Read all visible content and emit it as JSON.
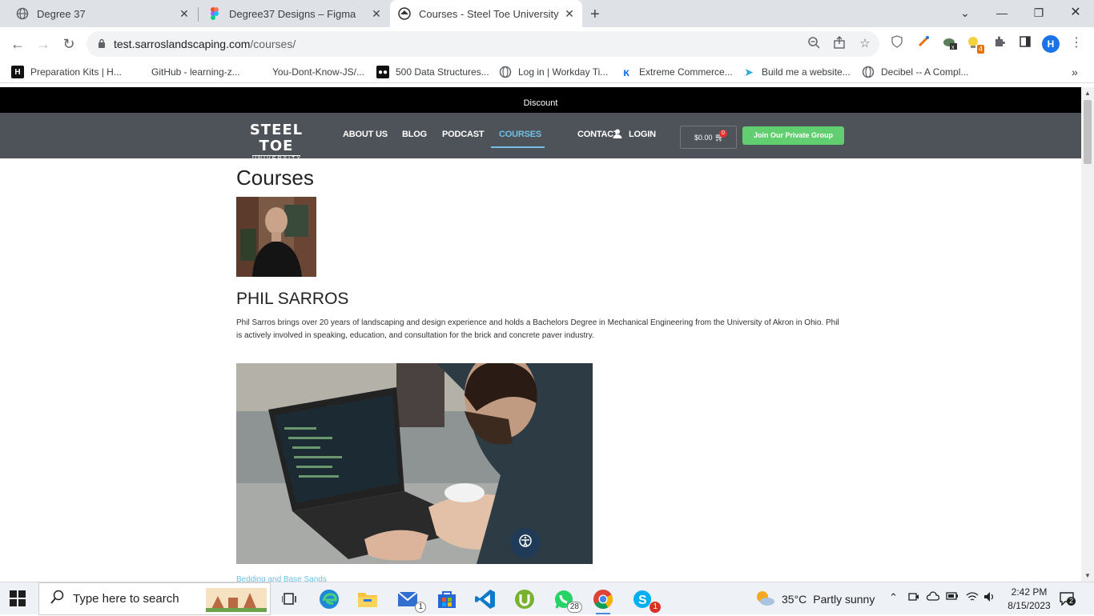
{
  "browser": {
    "tabs": [
      {
        "title": "Degree 37",
        "icon": "globe-icon"
      },
      {
        "title": "Degree37 Designs – Figma",
        "icon": "figma-icon"
      },
      {
        "title": "Courses - Steel Toe University",
        "icon": "site-icon",
        "active": true
      }
    ],
    "url_host": "test.sarroslandscaping.com",
    "url_path": "/courses/",
    "profile_initial": "H",
    "ext_badge": "4",
    "bookmarks": [
      "Preparation Kits | H...",
      "GitHub - learning-z...",
      "You-Dont-Know-JS/...",
      "500 Data Structures...",
      "Log in | Workday Ti...",
      "Extreme Commerce...",
      "Build me a website...",
      "Decibel -- A Compl..."
    ]
  },
  "site": {
    "announcement": "Discount",
    "logo_line1": "STEEL TOE",
    "logo_line2": "UNIVERSITY",
    "nav": [
      "ABOUT US",
      "BLOG",
      "PODCAST",
      "COURSES",
      "CONTACT",
      "LOGIN"
    ],
    "cart_total": "$0.00",
    "cart_count": "0",
    "join_button": "Join Our Private Group"
  },
  "page": {
    "title": "Courses",
    "instructor_name": "PHIL SARROS",
    "bio": "Phil Sarros brings over 20 years of landscaping and design experience and holds a Bachelors Degree in Mechanical Engineering from the University of Akron in Ohio. Phil is actively involved in speaking, education, and consultation for the brick and concrete paver industry.",
    "course_link": "Bedding and Base Sands"
  },
  "taskbar": {
    "search_placeholder": "Type here to search",
    "mail_count": "1",
    "whatsapp_count": "28",
    "skype_count": "1",
    "weather_temp": "35°C",
    "weather_text": "Partly sunny",
    "time": "2:42 PM",
    "date": "8/15/2023",
    "notif_count": "2"
  },
  "colors": {
    "nav_bg": "#4e5359",
    "accent": "#6ec1e4",
    "join_green": "#61ce70"
  }
}
